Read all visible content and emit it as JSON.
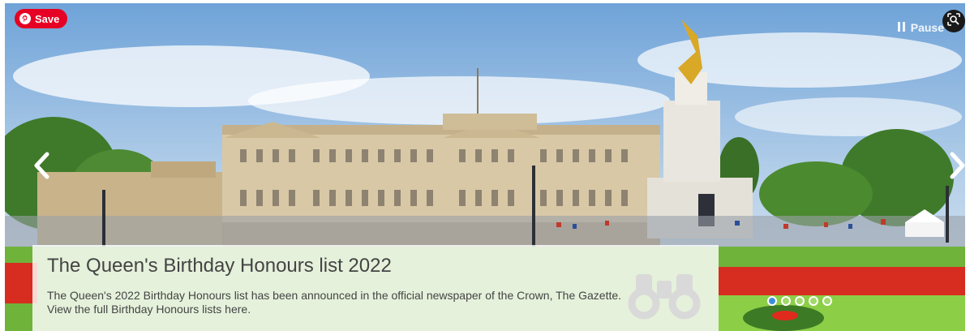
{
  "pin": {
    "save_label": "Save"
  },
  "controls": {
    "pause_label": "Pause"
  },
  "slide": {
    "title": "The Queen's Birthday Honours list 2022",
    "description": "The Queen's 2022 Birthday Honours list has been announced in the official newspaper of the Crown, The Gazette. View the full Birthday Honours lists here."
  },
  "pagination": {
    "count": 5,
    "active_index": 0
  },
  "colors": {
    "pin_red": "#e60023",
    "dot_active": "#3d8fdc"
  }
}
